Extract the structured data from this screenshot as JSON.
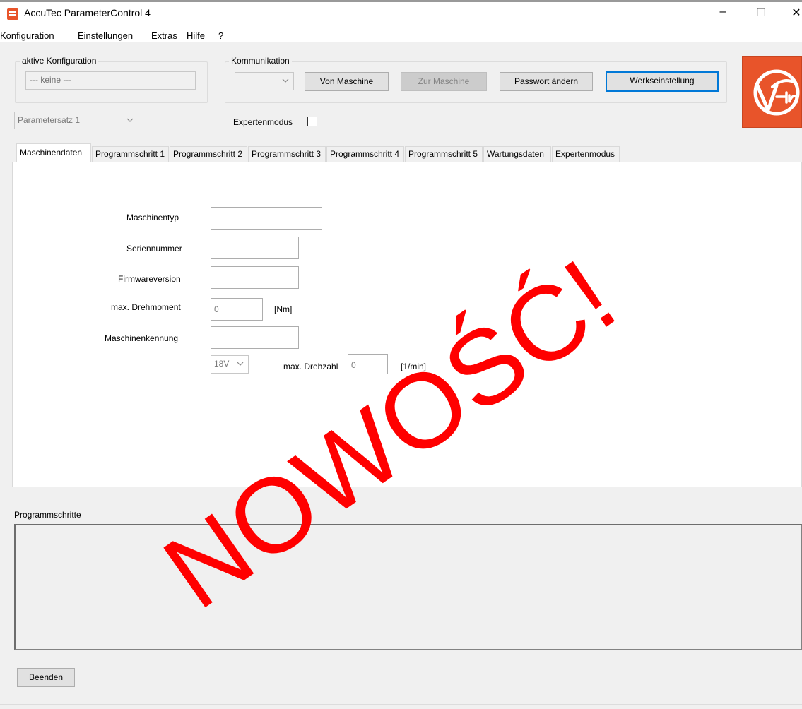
{
  "window": {
    "title": "AccuTec ParameterControl 4",
    "minimize_glyph": "–",
    "maximize_glyph": "☐",
    "close_glyph": "✕"
  },
  "menu": {
    "items": [
      "Konfiguration",
      "Einstellungen",
      "Extras",
      "Hilfe",
      "?"
    ]
  },
  "active_config": {
    "title": "aktive Konfiguration",
    "value": "--- keine ---"
  },
  "communication": {
    "title": "Kommunikation",
    "port_value": "",
    "btn_from_machine": "Von Maschine",
    "btn_to_machine": "Zur Maschine",
    "btn_change_password": "Passwort ändern",
    "btn_factory_settings": "Werkseinstellung"
  },
  "paramset": {
    "value": "Parametersatz 1"
  },
  "expert": {
    "label": "Expertenmodus",
    "checked": false
  },
  "tabs": [
    "Maschinendaten",
    "Programmschritt 1",
    "Programmschritt 2",
    "Programmschritt 3",
    "Programmschritt 4",
    "Programmschritt 5",
    "Wartungsdaten",
    "Expertenmodus"
  ],
  "machine_data": {
    "machine_type_label": "Maschinentyp",
    "machine_type_value": "",
    "serial_label": "Seriennummer",
    "serial_value": "",
    "firmware_label": "Firmwareversion",
    "firmware_value": "",
    "max_torque_label": "max. Drehmoment",
    "max_torque_value": "0",
    "torque_unit": "[Nm]",
    "machine_id_label": "Maschinenkennung",
    "machine_id_value": "",
    "voltage_value": "18V",
    "max_speed_label": "max. Drehzahl",
    "max_speed_value": "0",
    "speed_unit": "[1/min]"
  },
  "program_steps": {
    "title": "Programmschritte"
  },
  "footer": {
    "btn_exit": "Beenden"
  },
  "watermark": {
    "text": "NOWOŚĆ!",
    "color": "#ff0000"
  },
  "colors": {
    "accent": "#0078d7",
    "logo_red": "#e8542a",
    "window_bg": "#f0f0f0"
  },
  "logo": {
    "icon": "fein-logo-icon"
  }
}
